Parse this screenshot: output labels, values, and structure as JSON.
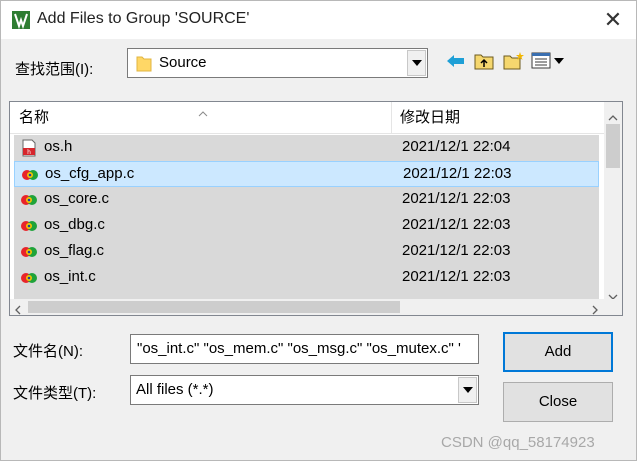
{
  "window": {
    "title": "Add Files to Group 'SOURCE'",
    "close_glyph": "✕"
  },
  "lookin": {
    "label": "查找范围(I):",
    "value": "Source"
  },
  "toolbar": {
    "icons": [
      "back-arrow-icon",
      "up-folder-icon",
      "new-folder-icon",
      "view-menu-icon"
    ]
  },
  "list": {
    "col_name": "名称",
    "col_date": "修改日期",
    "files": [
      {
        "name": "os.h",
        "date": "2021/12/1 22:04",
        "icon": "header-file-icon"
      },
      {
        "name": "os_cfg_app.c",
        "date": "2021/12/1 22:03",
        "icon": "c-file-icon",
        "selected": true
      },
      {
        "name": "os_core.c",
        "date": "2021/12/1 22:03",
        "icon": "c-file-icon"
      },
      {
        "name": "os_dbg.c",
        "date": "2021/12/1 22:03",
        "icon": "c-file-icon"
      },
      {
        "name": "os_flag.c",
        "date": "2021/12/1 22:03",
        "icon": "c-file-icon"
      },
      {
        "name": "os_int.c",
        "date": "2021/12/1 22:03",
        "icon": "c-file-icon"
      }
    ]
  },
  "filename": {
    "label": "文件名(N):",
    "value": "\"os_int.c\" \"os_mem.c\" \"os_msg.c\" \"os_mutex.c\" '"
  },
  "filetype": {
    "label": "文件类型(T):",
    "value": "All files (*.*)"
  },
  "buttons": {
    "add": "Add",
    "close": "Close"
  },
  "colors": {
    "selected_row": "#cce8ff",
    "highlighted_row": "#d9d9d9",
    "folder": "#ffd766",
    "default_button_border": "#0078d7"
  },
  "watermark": "CSDN @qq_58174923"
}
